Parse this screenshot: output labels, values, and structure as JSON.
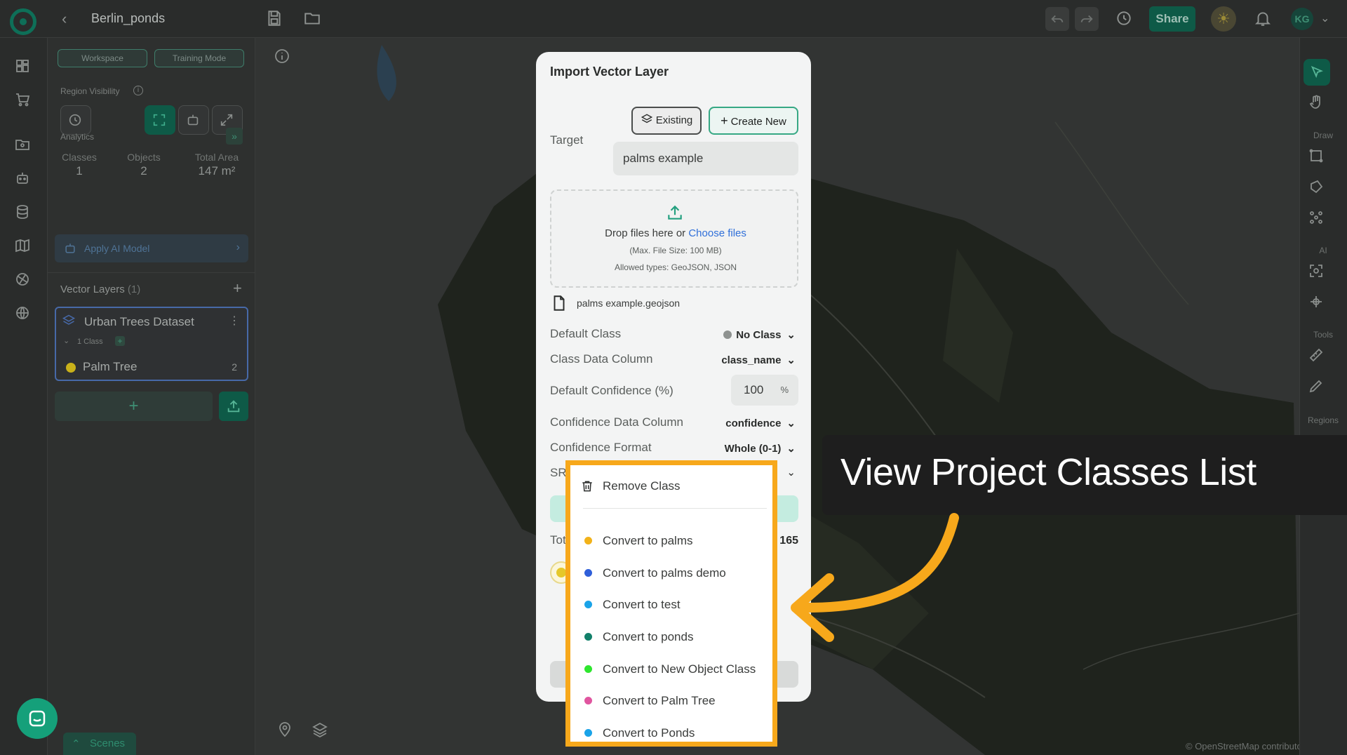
{
  "header": {
    "project_title": "Berlin_ponds",
    "share_label": "Share",
    "avatar_initials": "KG"
  },
  "left_panel": {
    "workspace_label": "Workspace",
    "training_mode_label": "Training Mode",
    "region_visibility_label": "Region Visibility",
    "analytics_label": "Analytics",
    "stats": {
      "classes_label": "Classes",
      "classes_value": "1",
      "objects_label": "Objects",
      "objects_value": "2",
      "area_label": "Total Area",
      "area_value": "147 m²"
    },
    "apply_ai_label": "Apply AI Model",
    "vector_layers_label": "Vector Layers",
    "vector_layers_count": "(1)",
    "layer": {
      "name": "Urban Trees Dataset",
      "class_count_label": "1 Class",
      "class_name": "Palm Tree",
      "class_count": "2",
      "class_color": "#c9b11a"
    }
  },
  "map": {
    "osm_credit": "© OpenStreetMap contributors"
  },
  "right_toolbar": {
    "draw_label": "Draw",
    "ai_label": "AI",
    "tools_label": "Tools",
    "regions_label": "Regions"
  },
  "modal": {
    "title": "Import Vector Layer",
    "existing_label": "Existing",
    "create_new_label": "Create New",
    "target_label": "Target",
    "target_value": "palms example",
    "drop_text": "Drop files here",
    "drop_or": "or",
    "choose_files": "Choose files",
    "max_size": "(Max. File Size: 100 MB)",
    "allowed_types": "Allowed types: GeoJSON, JSON",
    "file_name": "palms example.geojson",
    "default_class_label": "Default Class",
    "default_class_value": "No Class",
    "class_column_label": "Class Data Column",
    "class_column_value": "class_name",
    "default_confidence_label": "Default Confidence (%)",
    "default_confidence_value": "100",
    "percent_sign": "%",
    "confidence_column_label": "Confidence Data Column",
    "confidence_column_value": "confidence",
    "confidence_format_label": "Confidence Format",
    "confidence_format_value": "Whole (0-1)",
    "srs_label_partial": "SR",
    "total_label_partial": "Tot",
    "total_value_partial": "165"
  },
  "dropdown": {
    "remove_label": "Remove Class",
    "items": [
      {
        "label": "Convert to palms",
        "color": "#f2b219"
      },
      {
        "label": "Convert to palms demo",
        "color": "#2f5fd9"
      },
      {
        "label": "Convert to test",
        "color": "#1aa3e8"
      },
      {
        "label": "Convert to ponds",
        "color": "#12806a"
      },
      {
        "label": "Convert to New Object Class",
        "color": "#2ee62e"
      },
      {
        "label": "Convert to Palm Tree",
        "color": "#e0559f"
      },
      {
        "label": "Convert to Ponds",
        "color": "#1aa3e8"
      }
    ]
  },
  "annotation": {
    "callout_text": "View Project Classes List"
  },
  "footer": {
    "scenes_label": "Scenes"
  }
}
